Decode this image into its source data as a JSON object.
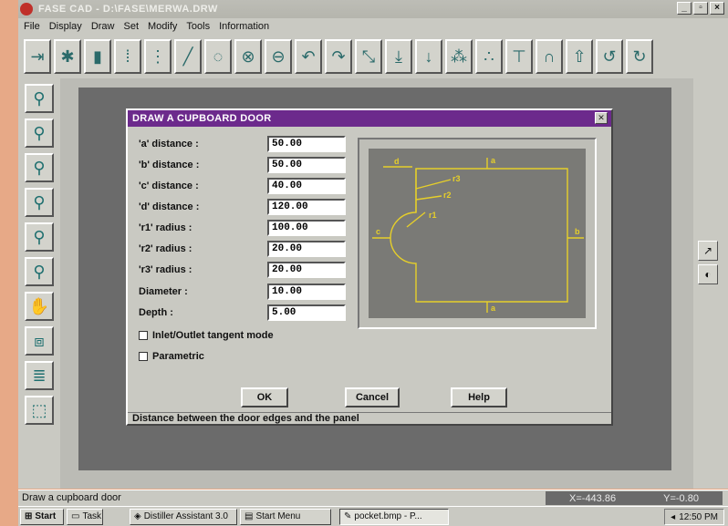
{
  "window": {
    "title": "FASE CAD - D:\\FASE\\MERWA.DRW",
    "controls": [
      "_",
      "×"
    ]
  },
  "menu": [
    "File",
    "Display",
    "Draw",
    "Set",
    "Modify",
    "Tools",
    "Information"
  ],
  "dialog": {
    "title": "DRAW A CUPBOARD DOOR",
    "fields": [
      {
        "label": "'a' distance :",
        "value": "50.00"
      },
      {
        "label": "'b' distance :",
        "value": "50.00"
      },
      {
        "label": "'c' distance :",
        "value": "40.00"
      },
      {
        "label": "'d' distance :",
        "value": "120.00"
      },
      {
        "label": "'r1' radius :",
        "value": "100.00"
      },
      {
        "label": "'r2' radius :",
        "value": "20.00"
      },
      {
        "label": "'r3' radius :",
        "value": "20.00"
      },
      {
        "label": "Diameter :",
        "value": "10.00"
      },
      {
        "label": "Depth :",
        "value": "5.00"
      }
    ],
    "checkboxes": [
      {
        "label": "Inlet/Outlet tangent mode"
      },
      {
        "label": "Parametric"
      }
    ],
    "buttons": {
      "ok": "OK",
      "cancel": "Cancel",
      "help": "Help"
    },
    "status": "Distance between the door edges and the panel",
    "preview_labels": {
      "a": "a",
      "b": "b",
      "c": "c",
      "d": "d",
      "r1": "r1",
      "r2": "r2",
      "r3": "r3"
    }
  },
  "status": {
    "message": "Draw a cupboard door",
    "x": "X=-443.86",
    "y": "Y=-0.80"
  },
  "taskbar": {
    "start": "Start",
    "items": [
      "Task",
      "Distiller Assistant 3.0",
      "Start Menu",
      "pocket.bmp - P..."
    ],
    "clock": "12:50 PM"
  },
  "colors": {
    "dialog_title": "#6c2a8c",
    "preview_lines": "#e6cf2a",
    "drawing_bg": "#6b6b6b"
  }
}
